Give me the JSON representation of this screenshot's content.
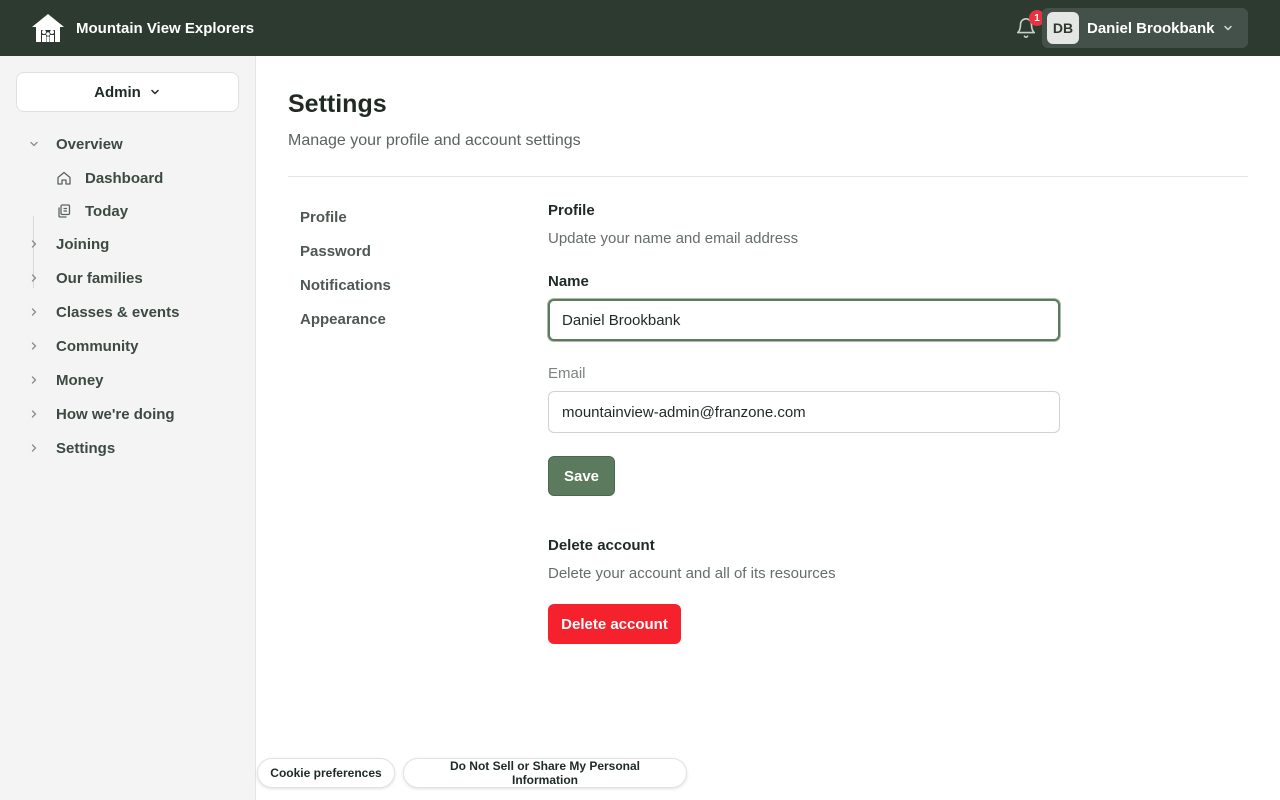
{
  "header": {
    "brand_name": "Mountain View Explorers",
    "notification_count": "1",
    "user_initials": "DB",
    "user_name": "Daniel Brookbank"
  },
  "sidebar": {
    "role_select": "Admin",
    "sections": [
      {
        "label": "Overview",
        "expanded": true
      },
      {
        "label": "Joining",
        "expanded": false
      },
      {
        "label": "Our families",
        "expanded": false
      },
      {
        "label": "Classes & events",
        "expanded": false
      },
      {
        "label": "Community",
        "expanded": false
      },
      {
        "label": "Money",
        "expanded": false
      },
      {
        "label": "How we're doing",
        "expanded": false
      },
      {
        "label": "Settings",
        "expanded": false
      }
    ],
    "overview_items": [
      {
        "label": "Dashboard",
        "icon": "home-icon"
      },
      {
        "label": "Today",
        "icon": "calendar-copy-icon"
      }
    ]
  },
  "page": {
    "title": "Settings",
    "subtitle": "Manage your profile and account settings"
  },
  "settings_nav": [
    "Profile",
    "Password",
    "Notifications",
    "Appearance"
  ],
  "profile": {
    "title": "Profile",
    "description": "Update your name and email address",
    "name_label": "Name",
    "name_value": "Daniel Brookbank",
    "email_label": "Email",
    "email_value": "mountainview-admin@franzone.com",
    "save_label": "Save"
  },
  "delete_account": {
    "title": "Delete account",
    "description": "Delete your account and all of its resources",
    "button_label": "Delete account"
  },
  "footer": {
    "cookie_label": "Cookie preferences",
    "privacy_label": "Do Not Sell or Share My Personal Information"
  },
  "colors": {
    "topbar": "#2c3a2f",
    "accent": "#5b7a5e",
    "danger": "#f5222d",
    "badge": "#e8323f"
  }
}
